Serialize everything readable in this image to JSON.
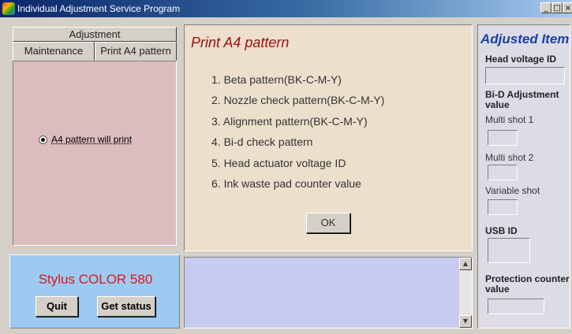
{
  "window": {
    "title": "Individual Adjustment Service Program",
    "minimize": "_",
    "maximize": "□",
    "close": "×"
  },
  "tabs": {
    "top": "Adjustment",
    "items": [
      "Maintenance",
      "Print A4 pattern"
    ]
  },
  "option": {
    "label": "A4 pattern will print",
    "selected": true
  },
  "center": {
    "title": "Print A4 pattern",
    "items": [
      "1. Beta pattern(BK-C-M-Y)",
      "2. Nozzle check pattern(BK-C-M-Y)",
      "3. Alignment pattern(BK-C-M-Y)",
      "4. Bi-d check pattern",
      "5. Head actuator voltage ID",
      "6. Ink waste pad counter value"
    ],
    "ok": "OK"
  },
  "right": {
    "title": "Adjusted Item",
    "head_voltage": "Head voltage ID",
    "bid_adjustment": "Bi-D Adjustment value",
    "multi_shot_1": "Multi shot 1",
    "multi_shot_2": "Multi shot 2",
    "variable_shot": "Variable shot",
    "usb_id": "USB ID",
    "protection_counter": "Protection counter value"
  },
  "device": {
    "name": "Stylus COLOR 580",
    "quit": "Quit",
    "get_status": "Get status"
  },
  "log": {
    "text": ""
  },
  "scrollbar": {
    "up": "▲",
    "down": "▼"
  },
  "colors": {
    "title_gradient_start": "#0a246a",
    "tab_content_bg": "#ddbcc0",
    "center_bg": "#ecdfcc",
    "center_title": "#a01010",
    "right_title": "#1c3fa8",
    "device_bg": "#9ccaf0",
    "device_name": "#e01515",
    "log_bg": "#c7cbf0"
  }
}
